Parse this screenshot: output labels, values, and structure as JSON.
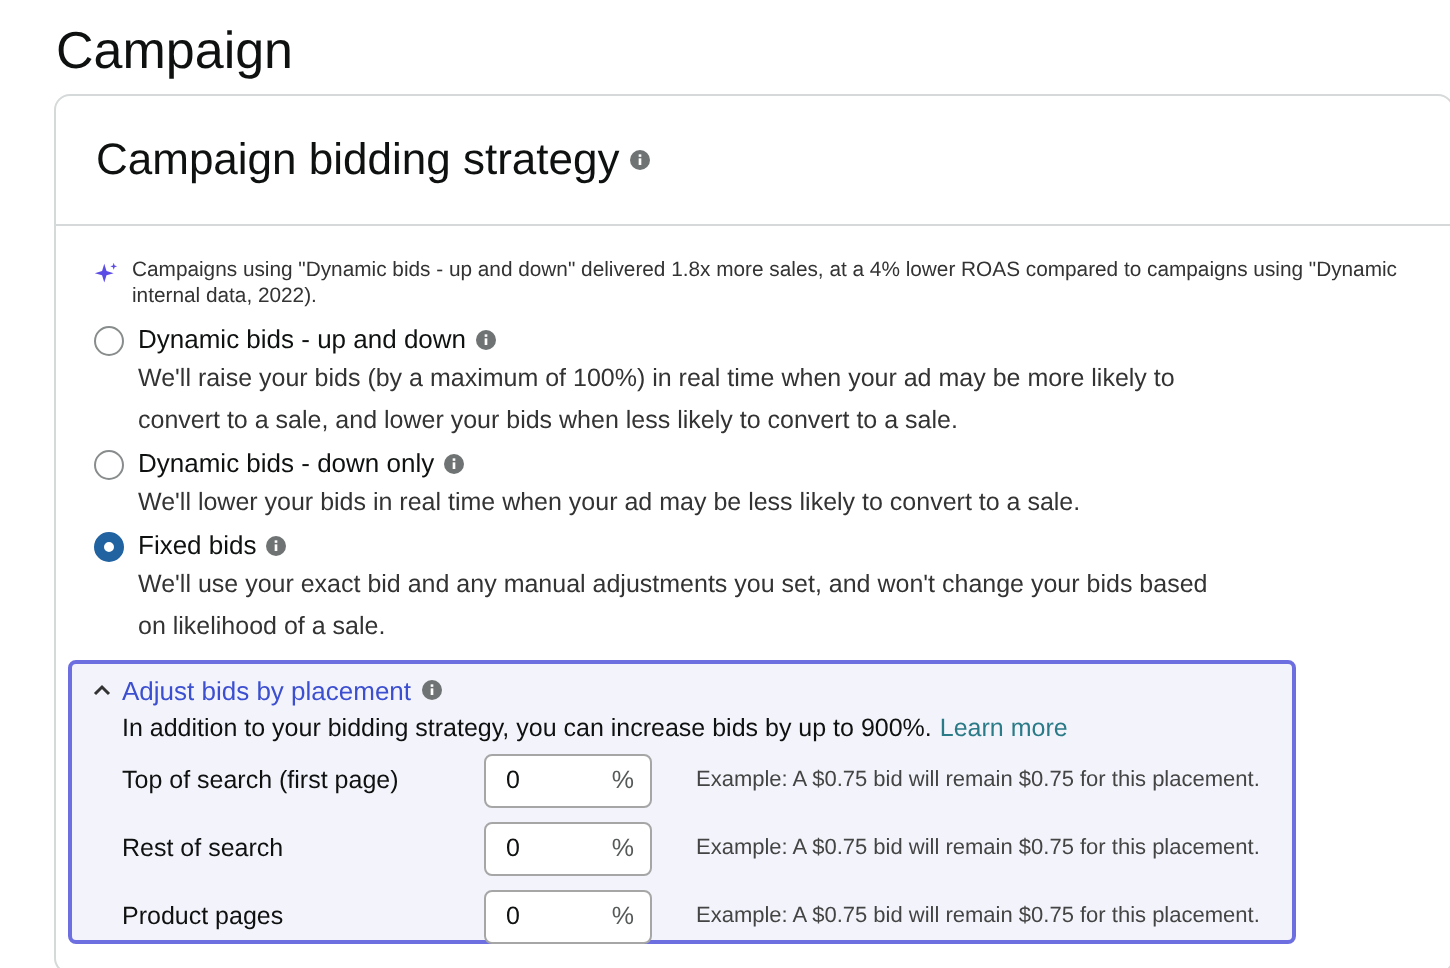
{
  "page_title": "Campaign",
  "card": {
    "title": "Campaign bidding strategy",
    "note": {
      "lines": [
        "Campaigns using \"Dynamic bids - up and down\" delivered 1.8x more sales, at a 4% lower ROAS compared to campaigns using \"Dynamic",
        "internal data, 2022)."
      ]
    },
    "options": [
      {
        "label": "Dynamic bids - up and down",
        "selected": false,
        "description": [
          "We'll raise your bids (by a maximum of 100%) in real time when your ad may be more likely to",
          "convert to a sale, and lower your bids when less likely to convert to a sale."
        ]
      },
      {
        "label": "Dynamic bids - down only",
        "selected": false,
        "description": [
          "We'll lower your bids in real time when your ad may be less likely to convert to a sale."
        ]
      },
      {
        "label": "Fixed bids",
        "selected": true,
        "description": [
          "We'll use your exact bid and any manual adjustments you set, and won't change your bids based",
          "on likelihood of a sale."
        ]
      }
    ],
    "placement": {
      "title": "Adjust bids by placement",
      "expanded": true,
      "intro": "In addition to your bidding strategy, you can increase bids by up to 900%.",
      "link": "Learn more",
      "rows": [
        {
          "label": "Top of search (first page)",
          "value": "0",
          "unit": "%",
          "example": "Example: A $0.75 bid will remain $0.75 for this placement."
        },
        {
          "label": "Rest of search",
          "value": "0",
          "unit": "%",
          "example": "Example: A $0.75 bid will remain $0.75 for this placement."
        },
        {
          "label": "Product pages",
          "value": "0",
          "unit": "%",
          "example": "Example: A $0.75 bid will remain $0.75 for this placement."
        }
      ]
    }
  }
}
